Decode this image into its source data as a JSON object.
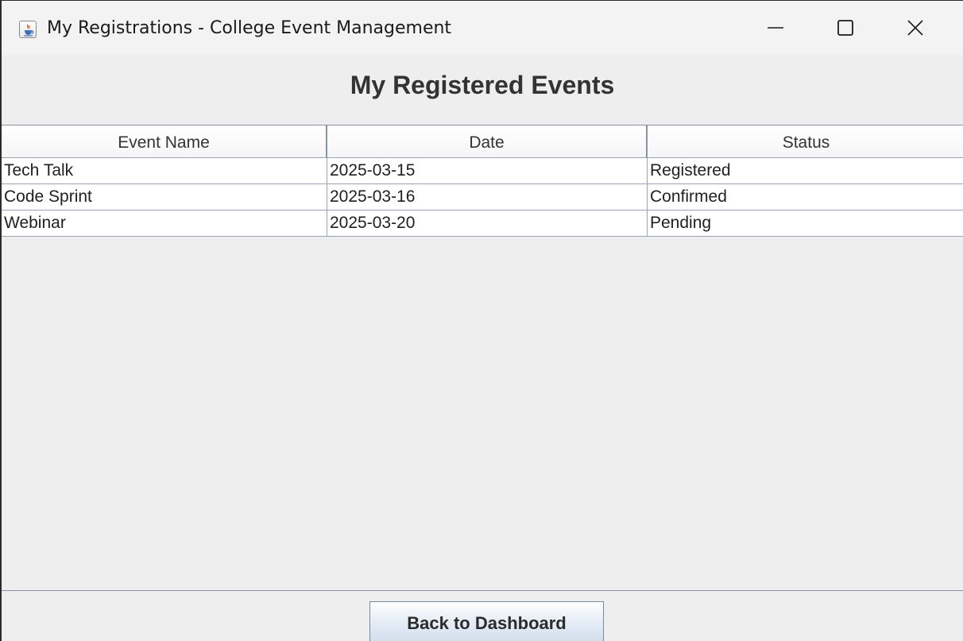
{
  "window": {
    "title": "My Registrations - College Event Management",
    "app_icon": "java-cup-icon",
    "controls": [
      "minimize-icon",
      "maximize-icon",
      "close-icon"
    ]
  },
  "page": {
    "heading": "My Registered Events"
  },
  "table": {
    "columns": [
      "Event Name",
      "Date",
      "Status"
    ],
    "rows": [
      [
        "Tech Talk",
        "2025-03-15",
        "Registered"
      ],
      [
        "Code Sprint",
        "2025-03-16",
        "Confirmed"
      ],
      [
        "Webinar",
        "2025-03-20",
        "Pending"
      ]
    ]
  },
  "footer": {
    "back_label": "Back to Dashboard"
  },
  "colors": {
    "window_bg": "#eeeeee",
    "grid_line": "#9aa3b3",
    "button_gradient_bottom": "#cfdcec"
  }
}
